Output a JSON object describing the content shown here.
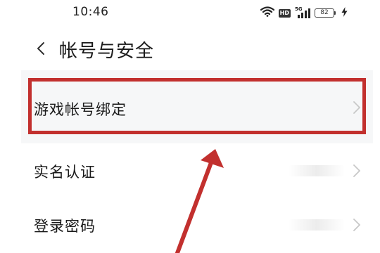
{
  "status_bar": {
    "time": "10:46",
    "network": "5G",
    "hd_label": "HD",
    "battery": "82",
    "icons": [
      "wifi-icon",
      "hd-icon",
      "signal-icon",
      "battery-icon",
      "charging-icon"
    ]
  },
  "header": {
    "title": "帐号与安全",
    "back_icon": "chevron-left-icon"
  },
  "list": {
    "items": [
      {
        "label": "游戏帐号绑定",
        "highlighted": true
      },
      {
        "label": "实名认证",
        "highlighted": false
      },
      {
        "label": "登录密码",
        "highlighted": false
      }
    ]
  },
  "annotation": {
    "highlight_color": "#c2302e",
    "arrow_color": "#c2302e",
    "arrow_icon": "arrow-up-right-icon"
  },
  "colors": {
    "selected_row_bg": "#f6f7f8",
    "text": "#1a1a1a",
    "chevron": "#c8c8c8"
  }
}
